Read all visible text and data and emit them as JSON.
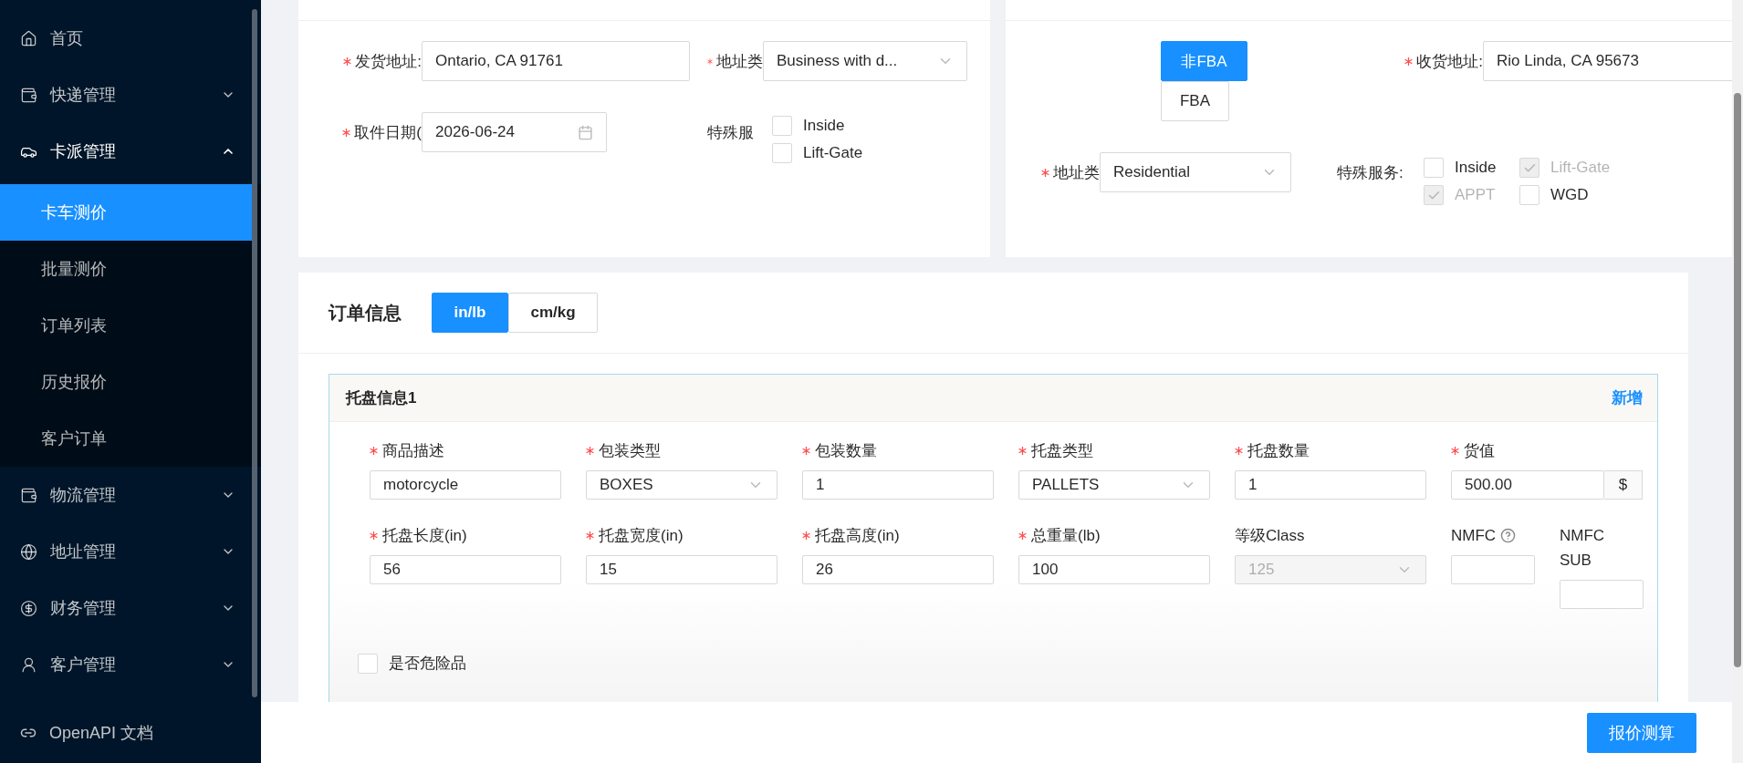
{
  "sidebar": {
    "items": [
      {
        "label": "首页",
        "kind": "link"
      },
      {
        "label": "快递管理",
        "kind": "group",
        "expanded": false
      },
      {
        "label": "卡派管理",
        "kind": "group",
        "expanded": true,
        "children": [
          {
            "label": "卡车测价",
            "selected": true
          },
          {
            "label": "批量测价",
            "selected": false
          },
          {
            "label": "订单列表",
            "selected": false
          },
          {
            "label": "历史报价",
            "selected": false
          },
          {
            "label": "客户订单",
            "selected": false
          }
        ]
      },
      {
        "label": "物流管理",
        "kind": "group",
        "expanded": false
      },
      {
        "label": "地址管理",
        "kind": "group",
        "expanded": false
      },
      {
        "label": "财务管理",
        "kind": "group",
        "expanded": false
      },
      {
        "label": "客户管理",
        "kind": "group",
        "expanded": false
      }
    ],
    "footer_link": "OpenAPI 文档"
  },
  "shipper": {
    "address": {
      "label": "发货地址:",
      "required": true,
      "value": "Ontario, CA 91761"
    },
    "address_type": {
      "label": "地址类",
      "required": true,
      "value": "Business with d..."
    },
    "pickup_date": {
      "label": "取件日期(",
      "required": true,
      "value": "2026-06-24"
    },
    "special_services": {
      "label": "特殊服",
      "options": [
        {
          "label": "Inside",
          "checked": false,
          "disabled": false
        },
        {
          "label": "Lift-Gate",
          "checked": false,
          "disabled": false
        }
      ]
    }
  },
  "consignee": {
    "fba_toggle": [
      {
        "label": "非FBA",
        "selected": true
      },
      {
        "label": "FBA",
        "selected": false
      }
    ],
    "address": {
      "label": "收货地址:",
      "required": true,
      "value": "Rio Linda, CA 95673"
    },
    "address_type": {
      "label": "地址类",
      "required": true,
      "value": "Residential"
    },
    "special_services": {
      "label": "特殊服务:",
      "options": [
        {
          "label": "Inside",
          "checked": false,
          "disabled": false
        },
        {
          "label": "Lift-Gate",
          "checked": true,
          "disabled": true
        },
        {
          "label": "APPT",
          "checked": true,
          "disabled": true
        },
        {
          "label": "WGD",
          "checked": false,
          "disabled": false
        }
      ]
    }
  },
  "order": {
    "title": "订单信息",
    "units": [
      {
        "label": "in/lb",
        "selected": true
      },
      {
        "label": "cm/kg",
        "selected": false
      }
    ],
    "pallets": [
      {
        "title": "托盘信息1",
        "add_link": "新增",
        "fields": [
          {
            "label": "商品描述",
            "required": true,
            "kind": "input",
            "value": "motorcycle"
          },
          {
            "label": "包装类型",
            "required": true,
            "kind": "select",
            "value": "BOXES"
          },
          {
            "label": "包装数量",
            "required": true,
            "kind": "input",
            "value": "1"
          },
          {
            "label": "托盘类型",
            "required": true,
            "kind": "select",
            "value": "PALLETS"
          },
          {
            "label": "托盘数量",
            "required": true,
            "kind": "input",
            "value": "1"
          },
          {
            "label": "货值",
            "required": true,
            "kind": "addon",
            "value": "500.00",
            "addon": "$"
          },
          {
            "label": "托盘长度(in)",
            "required": true,
            "kind": "input",
            "value": "56"
          },
          {
            "label": "托盘宽度(in)",
            "required": true,
            "kind": "input",
            "value": "15"
          },
          {
            "label": "托盘高度(in)",
            "required": true,
            "kind": "input",
            "value": "26"
          },
          {
            "label": "总重量(lb)",
            "required": true,
            "kind": "input",
            "value": "100"
          },
          {
            "label": "等级Class",
            "required": false,
            "kind": "select",
            "value": "125",
            "disabled": true
          },
          {
            "label": "NMFC",
            "required": false,
            "kind": "narrow",
            "help": true
          },
          {
            "label": "NMFC SUB",
            "required": false,
            "kind": "narrow",
            "help": false
          }
        ],
        "hazmat": {
          "label": "是否危险品",
          "checked": false
        }
      }
    ]
  },
  "submit_button": "报价测算"
}
